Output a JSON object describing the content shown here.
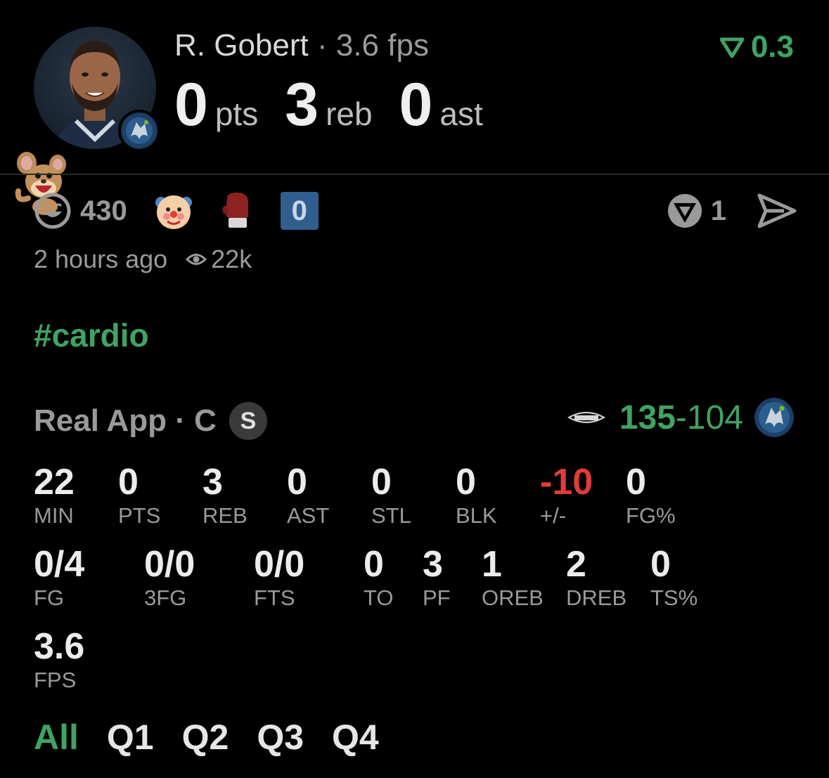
{
  "header": {
    "player_name": "R. Gobert",
    "separator": " · ",
    "fps_label": "3.6 fps",
    "delta_value": "0.3",
    "accent_color": "#3fa363",
    "statline": [
      {
        "value": "0",
        "unit": "pts"
      },
      {
        "value": "3",
        "unit": "reb"
      },
      {
        "value": "0",
        "unit": "ast"
      }
    ]
  },
  "reactions": {
    "laugh_count": "430",
    "box_count": "0",
    "v_count": "1",
    "icons": [
      "laugh-face-icon",
      "clown-face-icon",
      "boxing-glove-icon",
      "v-logo-icon",
      "send-icon"
    ]
  },
  "meta": {
    "time_ago": "2 hours ago",
    "views": "22k"
  },
  "hashtag": "#cardio",
  "source": {
    "label": "Real App · C",
    "badge": "S",
    "score_home": "135",
    "score_sep": "-",
    "score_away": "104"
  },
  "stats_row1": [
    {
      "value": "22",
      "label": "MIN"
    },
    {
      "value": "0",
      "label": "PTS"
    },
    {
      "value": "3",
      "label": "REB"
    },
    {
      "value": "0",
      "label": "AST"
    },
    {
      "value": "0",
      "label": "STL"
    },
    {
      "value": "0",
      "label": "BLK"
    },
    {
      "value": "-10",
      "label": "+/-"
    },
    {
      "value": "0",
      "label": "FG%"
    }
  ],
  "stats_row2": [
    {
      "value": "0/4",
      "label": "FG"
    },
    {
      "value": "0/0",
      "label": "3FG"
    },
    {
      "value": "0/0",
      "label": "FTS"
    },
    {
      "value": "0",
      "label": "TO"
    },
    {
      "value": "3",
      "label": "PF"
    },
    {
      "value": "1",
      "label": "OREB"
    },
    {
      "value": "2",
      "label": "DREB"
    },
    {
      "value": "0",
      "label": "TS%"
    }
  ],
  "stats_row3": [
    {
      "value": "3.6",
      "label": "FPS"
    }
  ],
  "tabs": [
    "All",
    "Q1",
    "Q2",
    "Q3",
    "Q4"
  ],
  "active_tab": "All",
  "colors": {
    "positive": "#3fa363",
    "negative": "#e23c37",
    "muted": "#9a9a9a",
    "background": "#000000"
  }
}
